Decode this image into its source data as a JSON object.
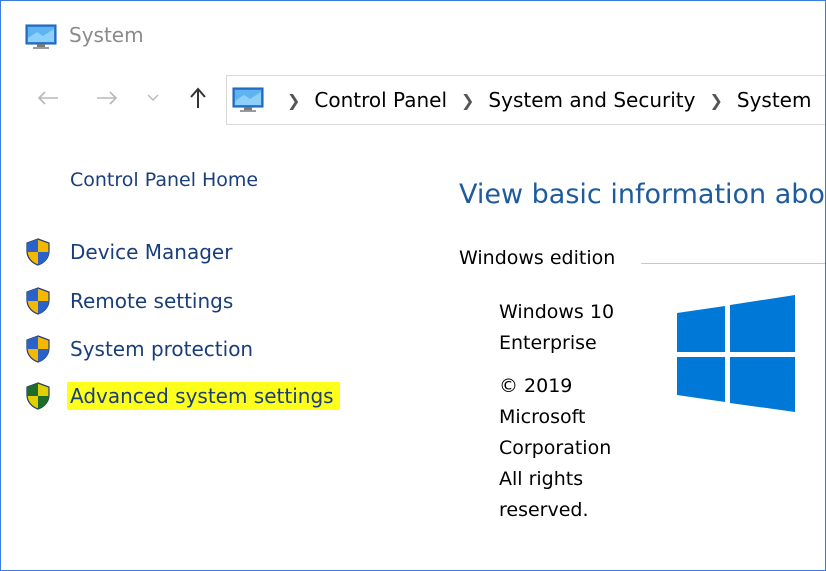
{
  "window": {
    "title": "System",
    "title_icon": "computer-monitor-icon"
  },
  "nav": {
    "back_icon": "arrow-left-icon",
    "forward_icon": "arrow-right-icon",
    "recent_icon": "chevron-down-icon",
    "up_icon": "arrow-up-icon",
    "breadcrumbs": [
      "Control Panel",
      "System and Security",
      "System"
    ]
  },
  "sidebar": {
    "home_label": "Control Panel Home",
    "items": [
      {
        "label": "Device Manager",
        "icon": "uac-shield-icon"
      },
      {
        "label": "Remote settings",
        "icon": "uac-shield-icon"
      },
      {
        "label": "System protection",
        "icon": "uac-shield-icon"
      },
      {
        "label": "Advanced system settings",
        "icon": "uac-shield-icon",
        "highlighted": true
      }
    ]
  },
  "main": {
    "heading": "View basic information about your computer",
    "windows_edition": {
      "section_label": "Windows edition",
      "edition_lines": [
        "Windows 10",
        "Enterprise"
      ],
      "copyright_lines": [
        "© 2019",
        "Microsoft",
        "Corporation",
        "All rights",
        "reserved."
      ],
      "logo_icon": "windows-logo-icon"
    }
  },
  "colors": {
    "link": "#1a3e7a",
    "heading": "#1e5b9e",
    "highlight": "#ffff1c",
    "windows_logo": "#0078d7",
    "window_border": "#3d7be0"
  }
}
